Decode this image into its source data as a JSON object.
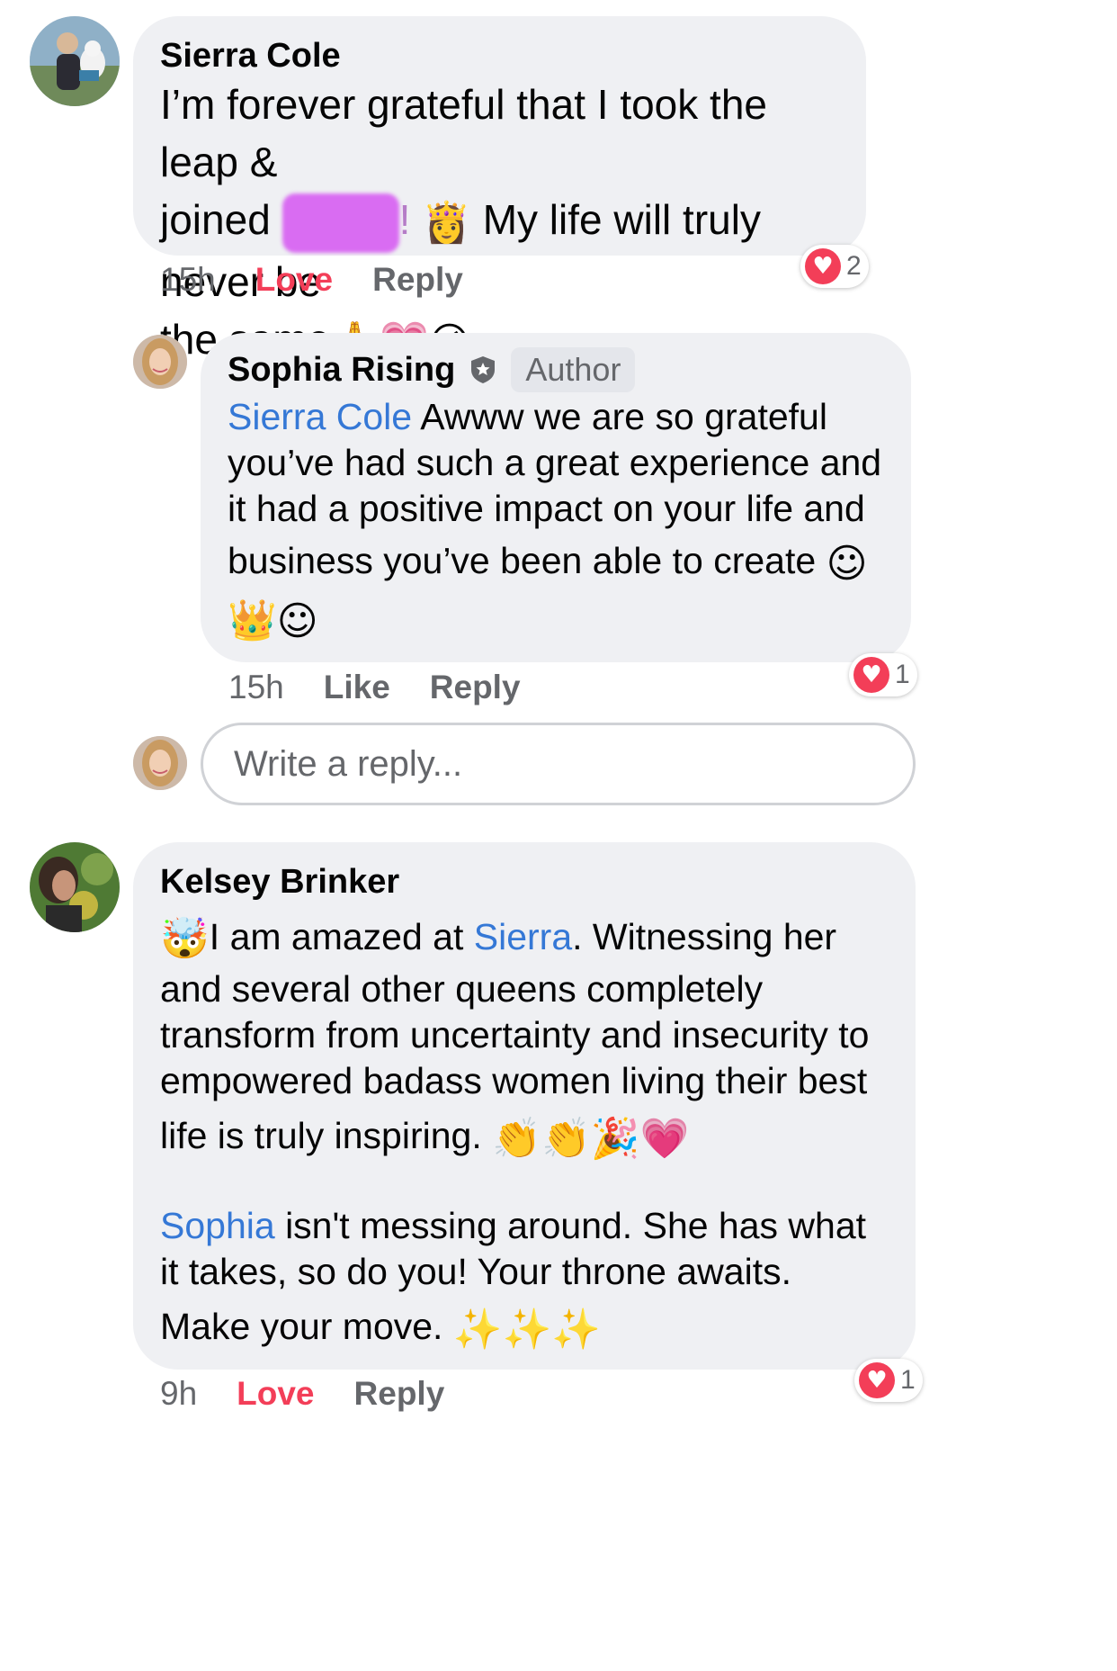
{
  "comments": [
    {
      "author": "Sierra Cole",
      "text_line1": "I’m forever grateful that I took the leap &",
      "text_line2_a": "joined",
      "text_line2_b": "!",
      "text_line2_c": "My life will truly never be",
      "text_line3": "the same",
      "time": "15h",
      "action_love": "Love",
      "action_reply": "Reply",
      "reaction_count": "2"
    },
    {
      "author": "Sophia Rising",
      "badge": "Author",
      "mention": "Sierra Cole",
      "text_line1": " Awww we are so grateful",
      "text_line2": "you’ve had such a great experience and",
      "text_line3": "it had a positive impact on your life and",
      "text_line4": "business you’ve been able to create",
      "time": "15h",
      "action_like": "Like",
      "action_reply": "Reply",
      "reaction_count": "1"
    },
    {
      "author": "Kelsey Brinker",
      "text_line1_a": "I am amazed at ",
      "mention1": "Sierra",
      "text_line1_b": ".  Witnessing her",
      "text_line2": "and several other queens completely",
      "text_line3": "transform from uncertainty and insecurity to",
      "text_line4": "empowered badass women living their best",
      "text_line5": "life is truly inspiring.",
      "mention2": "Sophia",
      "text_line6_b": " isn't messing around. She has what",
      "text_line7": "it takes, so do you! Your throne awaits.",
      "text_line8": "Make your move.",
      "time": "9h",
      "action_love": "Love",
      "action_reply": "Reply",
      "reaction_count": "1"
    }
  ],
  "reply_box": {
    "placeholder": "Write a reply..."
  },
  "icons": {
    "reaction": "heart-icon",
    "verified": "shield-star-icon"
  },
  "colors": {
    "bubble": "#eff0f3",
    "mention": "#3578d6",
    "love": "#f33e58",
    "meta": "#65676b"
  }
}
